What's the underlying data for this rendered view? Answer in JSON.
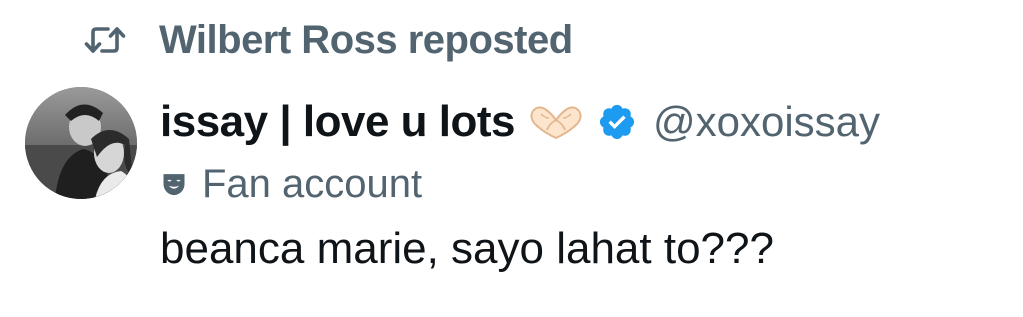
{
  "repost": {
    "icon": "repost-icon",
    "text": "Wilbert Ross reposted"
  },
  "author": {
    "avatar_icon": "avatar-photo",
    "display_name": "issay | love u lots",
    "name_emoji_icon": "heart-hands-icon",
    "verified_icon": "verified-badge-icon",
    "handle": "@xoxoissay"
  },
  "account_label": {
    "icon": "theater-mask-icon",
    "text": "Fan account"
  },
  "tweet": {
    "text": "beanca marie, sayo lahat to???"
  },
  "colors": {
    "primary_text": "#0f1419",
    "secondary_text": "#536471",
    "verified_blue": "#1d9bf0",
    "background": "#ffffff"
  }
}
